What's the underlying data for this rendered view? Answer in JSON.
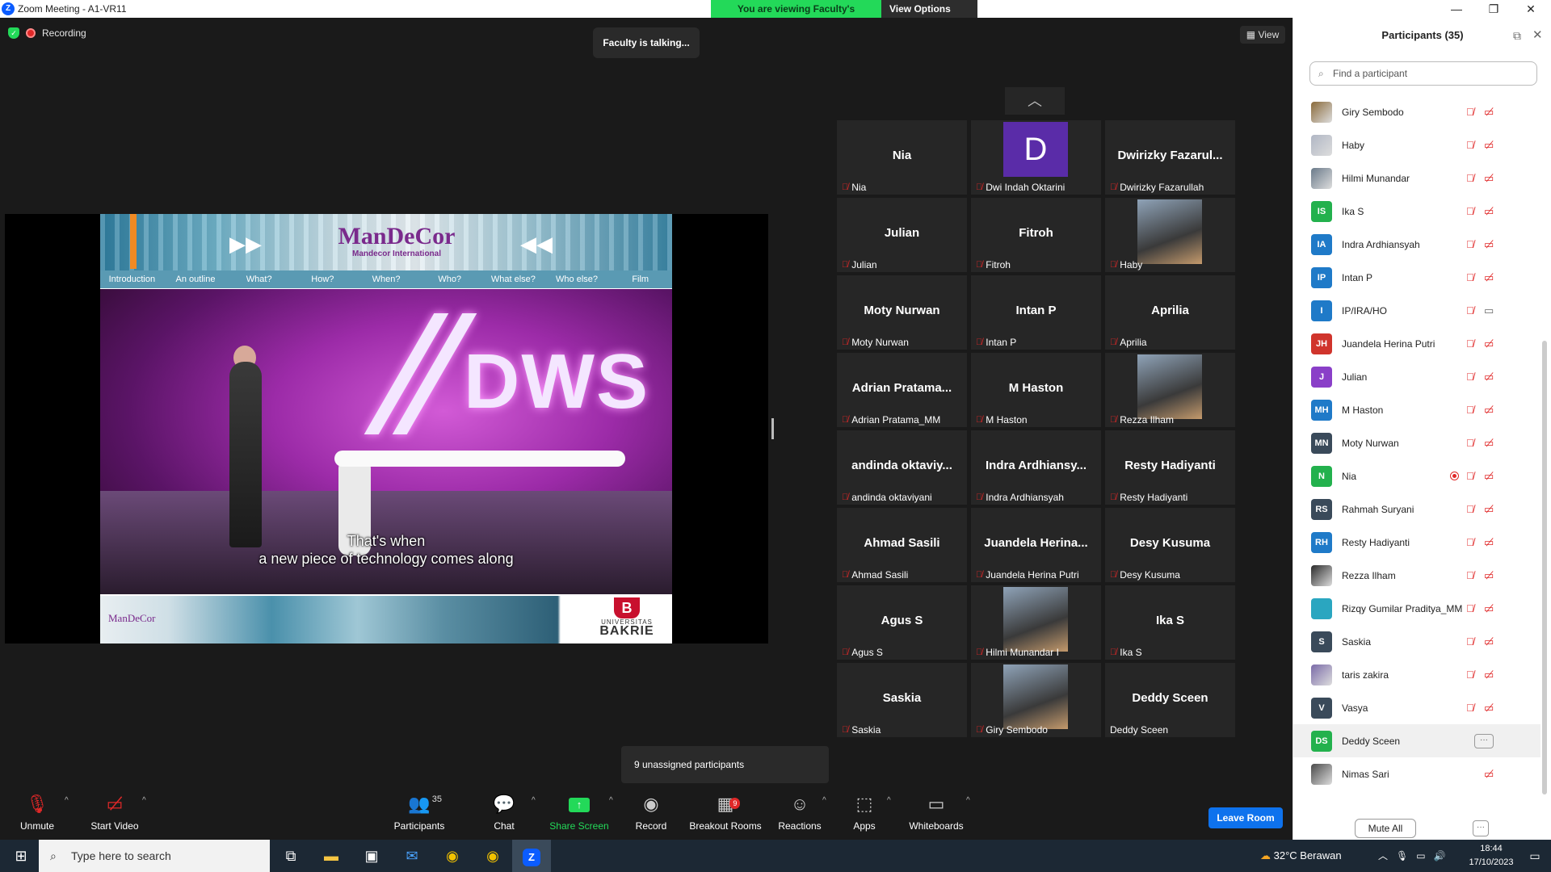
{
  "window": {
    "title": "Zoom Meeting - A1-VR11",
    "minimize": "—",
    "restore": "❐",
    "close": "✕"
  },
  "banner": {
    "viewing": "You are viewing Faculty's screen",
    "view_options": "View Options",
    "caret": "⌄"
  },
  "status": {
    "recording": "Recording",
    "talking": "Faculty is talking...",
    "view": "View"
  },
  "slide": {
    "logo": "ManDeCor",
    "logo_sub": "Mandecor International",
    "nav": [
      "Introduction",
      "An outline",
      "What?",
      "How?",
      "When?",
      "Who?",
      "What else?",
      "Who else?",
      "Film"
    ],
    "video_title": "DWS",
    "subtitle_line1": "That's when",
    "subtitle_line2": "a new piece of technology comes along",
    "footer_logo": "ManDeCor",
    "univ_mark": "B",
    "univ_line1": "UNIVERSITAS",
    "univ_line2": "BAKRIE"
  },
  "gallery": {
    "up_icon": "︿",
    "tiles": [
      {
        "big": "Nia",
        "name": "Nia"
      },
      {
        "big": "",
        "name": "Dwi Indah Oktarini",
        "letter": "D"
      },
      {
        "big": "Dwirizky  Fazarul...",
        "name": "Dwirizky Fazarullah"
      },
      {
        "big": "Julian",
        "name": "Julian"
      },
      {
        "big": "Fitroh",
        "name": "Fitroh"
      },
      {
        "big": "",
        "name": "Haby",
        "photo": true
      },
      {
        "big": "Moty Nurwan",
        "name": "Moty Nurwan"
      },
      {
        "big": "Intan P",
        "name": "Intan P"
      },
      {
        "big": "Aprilia",
        "name": "Aprilia"
      },
      {
        "big": "Adrian  Pratama...",
        "name": "Adrian Pratama_MM"
      },
      {
        "big": "M Haston",
        "name": "M Haston"
      },
      {
        "big": "",
        "name": "Rezza Ilham",
        "photo": true
      },
      {
        "big": "andinda  oktaviy...",
        "name": "andinda oktaviyani"
      },
      {
        "big": "Indra  Ardhiansy...",
        "name": "Indra Ardhiansyah"
      },
      {
        "big": "Resty Hadiyanti",
        "name": "Resty Hadiyanti"
      },
      {
        "big": "Ahmad Sasili",
        "name": "Ahmad Sasili"
      },
      {
        "big": "Juandela  Herina...",
        "name": "Juandela Herina Putri"
      },
      {
        "big": "Desy Kusuma",
        "name": "Desy Kusuma"
      },
      {
        "big": "Agus S",
        "name": "Agus S"
      },
      {
        "big": "",
        "name": "Hilmi Munandar I",
        "photo": true
      },
      {
        "big": "Ika S",
        "name": "Ika S"
      },
      {
        "big": "Saskia",
        "name": "Saskia"
      },
      {
        "big": "",
        "name": "Giry Sembodo",
        "photo": true
      },
      {
        "big": "Deddy Sceen",
        "name": "Deddy Sceen",
        "nomute": true
      }
    ]
  },
  "unassigned": "9 unassigned participants",
  "toolbar": {
    "unmute": "Unmute",
    "start_video": "Start Video",
    "participants": "Participants",
    "participants_count": "35",
    "chat": "Chat",
    "share_screen": "Share Screen",
    "record": "Record",
    "breakout_rooms": "Breakout Rooms",
    "breakout_badge": "9",
    "reactions": "Reactions",
    "apps": "Apps",
    "whiteboards": "Whiteboards",
    "leave_room": "Leave Room",
    "caret": "^"
  },
  "panel": {
    "title": "Participants (35)",
    "search_placeholder": "Find a participant",
    "participants": [
      {
        "name": "Giry Sembodo",
        "initials": "",
        "color": "#8a6a3a",
        "photo": true
      },
      {
        "name": "Haby",
        "initials": "",
        "color": "#b0b6c4",
        "photo": true
      },
      {
        "name": "Hilmi Munandar",
        "initials": "",
        "color": "#6a7a8a",
        "photo": true
      },
      {
        "name": "Ika S",
        "initials": "IS",
        "color": "#23b14d"
      },
      {
        "name": "Indra Ardhiansyah",
        "initials": "IA",
        "color": "#1f7ac8"
      },
      {
        "name": "Intan P",
        "initials": "IP",
        "color": "#1f7ac8"
      },
      {
        "name": "IP/IRA/HO",
        "initials": "I",
        "color": "#1f7ac8",
        "camon": true
      },
      {
        "name": "Juandela Herina Putri",
        "initials": "JH",
        "color": "#d0342c"
      },
      {
        "name": "Julian",
        "initials": "J",
        "color": "#8a3fc8"
      },
      {
        "name": "M Haston",
        "initials": "MH",
        "color": "#1f7ac8"
      },
      {
        "name": "Moty Nurwan",
        "initials": "MN",
        "color": "#3a4a5a"
      },
      {
        "name": "Nia",
        "initials": "N",
        "color": "#23b14d",
        "rec": true
      },
      {
        "name": "Rahmah Suryani",
        "initials": "RS",
        "color": "#3a4a5a"
      },
      {
        "name": "Resty Hadiyanti",
        "initials": "RH",
        "color": "#1f7ac8"
      },
      {
        "name": "Rezza Ilham",
        "initials": "",
        "color": "#2a2a2a",
        "photo": true
      },
      {
        "name": "Rizqy Gumilar Praditya_MM",
        "initials": "",
        "color": "#2aa6c0"
      },
      {
        "name": "Saskia",
        "initials": "S",
        "color": "#3a4a5a"
      },
      {
        "name": "taris zakira",
        "initials": "",
        "color": "#7a6aa8",
        "photo": true
      },
      {
        "name": "Vasya",
        "initials": "V",
        "color": "#3a4a5a"
      },
      {
        "name": "Deddy Sceen",
        "initials": "DS",
        "color": "#23b14d",
        "highlight": true
      },
      {
        "name": "Nimas Sari",
        "initials": "",
        "color": "#4a4a4a",
        "photo": true,
        "nomic": true
      }
    ],
    "more_label": "···",
    "mute_all": "Mute All"
  },
  "taskbar": {
    "search_placeholder": "Type here to search",
    "weather": "32°C  Berawan",
    "time": "18:44",
    "date": "17/10/2023"
  },
  "colors": {
    "zoom_blue": "#0b5cff",
    "banner_green": "#23d959",
    "leave_blue": "#0e72ed",
    "muted_red": "#e02828"
  }
}
